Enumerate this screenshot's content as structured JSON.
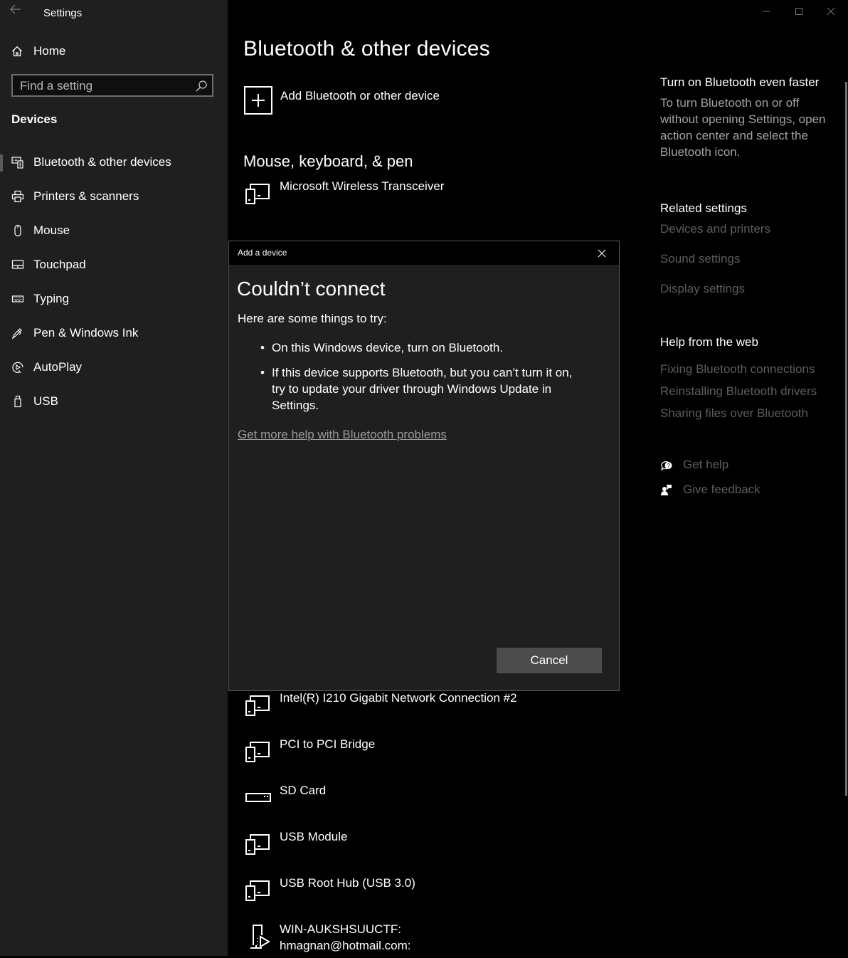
{
  "window": {
    "app_title": "Settings",
    "controls": {
      "minimize": "minimize-icon",
      "maximize": "maximize-icon",
      "close": "close-icon"
    }
  },
  "sidebar": {
    "home_label": "Home",
    "search_placeholder": "Find a setting",
    "search_value": "",
    "section_title": "Devices",
    "items": [
      {
        "label": "Bluetooth & other devices",
        "icon": "bluetooth-devices-icon",
        "selected": true
      },
      {
        "label": "Printers & scanners",
        "icon": "printer-icon",
        "selected": false
      },
      {
        "label": "Mouse",
        "icon": "mouse-icon",
        "selected": false
      },
      {
        "label": "Touchpad",
        "icon": "touchpad-icon",
        "selected": false
      },
      {
        "label": "Typing",
        "icon": "keyboard-icon",
        "selected": false
      },
      {
        "label": "Pen & Windows Ink",
        "icon": "pen-icon",
        "selected": false
      },
      {
        "label": "AutoPlay",
        "icon": "autoplay-icon",
        "selected": false
      },
      {
        "label": "USB",
        "icon": "usb-icon",
        "selected": false
      }
    ]
  },
  "main": {
    "page_title": "Bluetooth & other devices",
    "add_device_label": "Add Bluetooth or other device",
    "group_title": "Mouse, keyboard, & pen",
    "devices_top": [
      {
        "name": "Microsoft Wireless Transceiver",
        "icon": "device-icon"
      }
    ],
    "devices_bottom": [
      {
        "name": "Intel(R) I210 Gigabit Network Connection #2",
        "icon": "device-icon"
      },
      {
        "name": "PCI to PCI Bridge",
        "icon": "device-icon"
      },
      {
        "name": "SD Card",
        "icon": "drive-icon"
      },
      {
        "name": "USB Module",
        "icon": "device-icon"
      },
      {
        "name": "USB Root Hub (USB 3.0)",
        "icon": "device-icon"
      },
      {
        "name": "WIN-AUKSHSUUCTF: hmagnan@hotmail.com:",
        "line1": "WIN-AUKSHSUUCTF:",
        "line2": "hmagnan@hotmail.com:",
        "icon": "media-server-icon"
      }
    ]
  },
  "right_panel": {
    "tip_title": "Turn on Bluetooth even faster",
    "tip_text": "To turn Bluetooth on or off without opening Settings, open action center and select the Bluetooth icon.",
    "related_title": "Related settings",
    "related_links": [
      "Devices and printers",
      "Sound settings",
      "Display settings"
    ],
    "help_title": "Help from the web",
    "help_links": [
      "Fixing Bluetooth connections",
      "Reinstalling Bluetooth drivers",
      "Sharing files over Bluetooth"
    ],
    "get_help": "Get help",
    "give_feedback": "Give feedback"
  },
  "dialog": {
    "title": "Add a device",
    "heading": "Couldn’t connect",
    "intro": "Here are some things to try:",
    "tips": [
      "On this Windows device, turn on Bluetooth.",
      "If this device supports Bluetooth, but you can’t turn it on, try to update your driver through Windows Update in Settings."
    ],
    "help_link": "Get more help with Bluetooth problems",
    "cancel_label": "Cancel"
  },
  "colors": {
    "sidebar_bg": "#1f1f1f",
    "main_bg": "#000000",
    "dialog_bg": "#1f1f1f",
    "button_bg": "#4c4c4c",
    "link_dim": "#5d5d5d",
    "text_secondary": "#a3a3a3"
  }
}
